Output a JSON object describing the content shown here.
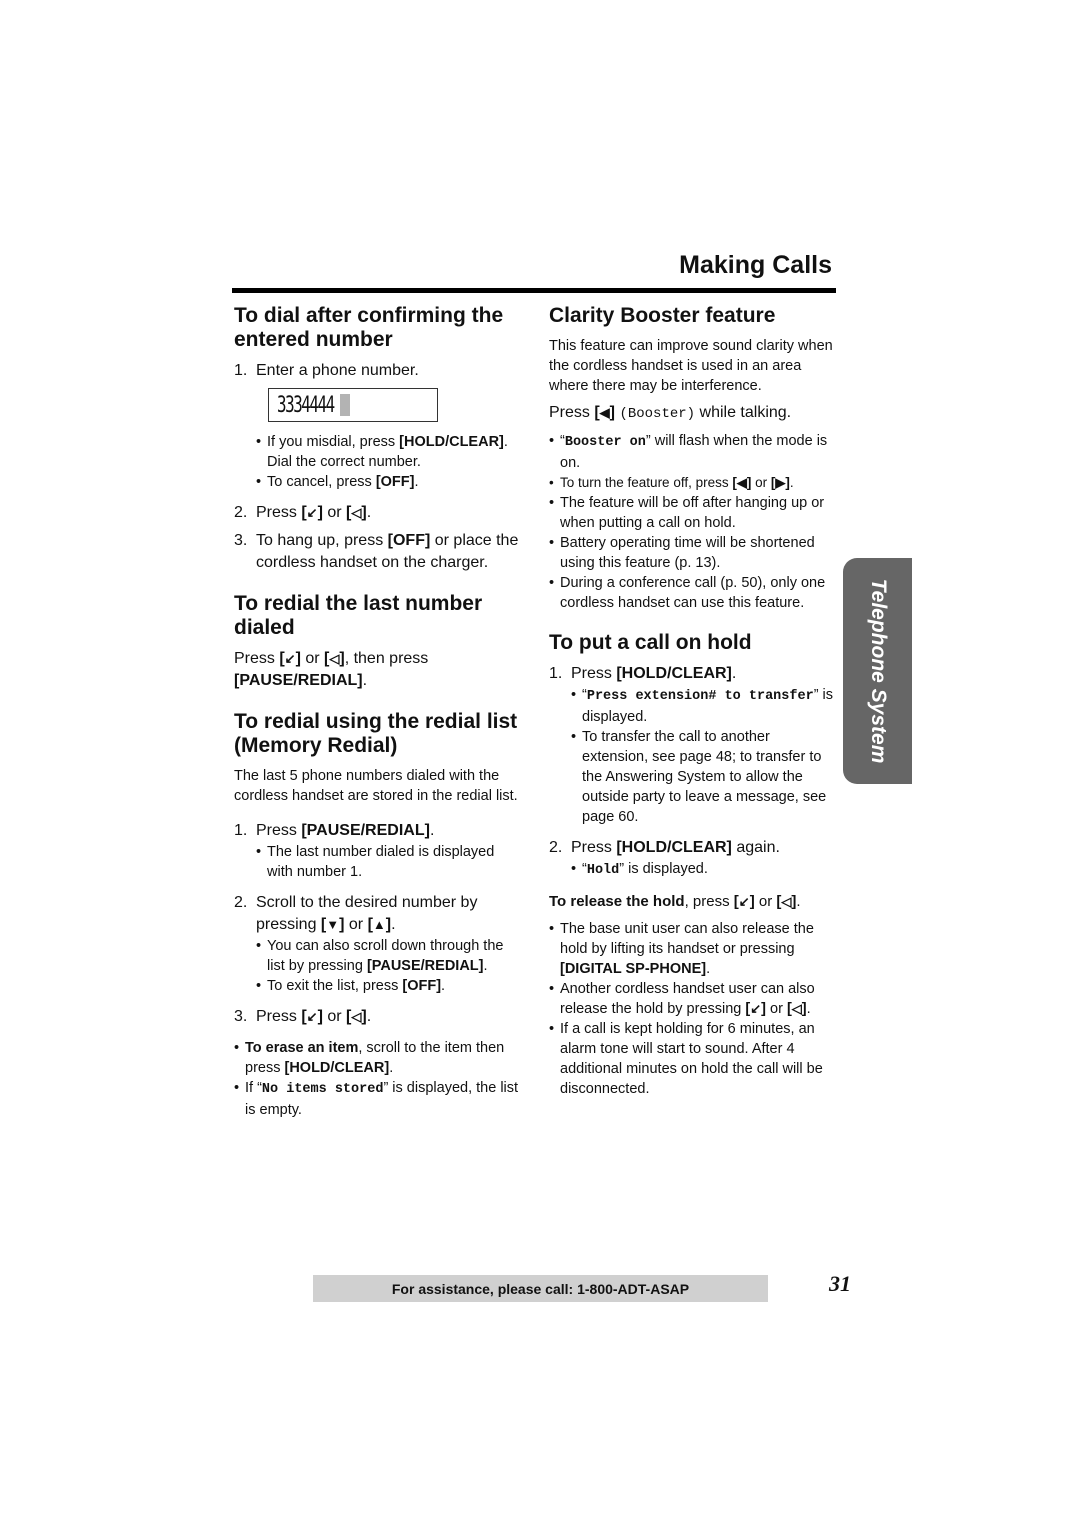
{
  "header": {
    "title": "Making Calls"
  },
  "side_tab": {
    "label": "Telephone System"
  },
  "icons": {
    "talk": "↙",
    "speaker": "◁",
    "down": "▼",
    "up": "▲",
    "left": "◀",
    "right": "▶"
  },
  "left": {
    "dial_confirm": {
      "heading": "To dial after confirming the entered number",
      "step1": {
        "num": "1.",
        "text": "Enter a phone number."
      },
      "display": {
        "digits": "3334444"
      },
      "bullets": {
        "b1_pre": "If you misdial, press ",
        "b1_key": "[HOLD/CLEAR]",
        "b1_post": ". Dial the correct number.",
        "b2_pre": "To cancel, press ",
        "b2_key": "[OFF]",
        "b2_post": "."
      },
      "step2": {
        "num": "2.",
        "pre": "Press ",
        "or": " or ",
        "post": "."
      },
      "step3": {
        "num": "3.",
        "pre": "To hang up, press ",
        "key": "[OFF]",
        "post": " or place the cordless handset on the charger."
      }
    },
    "redial_last": {
      "heading": "To redial the last number dialed",
      "pre": "Press ",
      "or": " or ",
      "mid": ", then press ",
      "key": "[PAUSE/REDIAL]",
      "post": "."
    },
    "memory_redial": {
      "heading": "To redial using the redial list (Memory Redial)",
      "intro": "The last 5 phone numbers dialed with the cordless handset are stored in the redial list.",
      "step1": {
        "num": "1.",
        "pre": "Press ",
        "key": "[PAUSE/REDIAL]",
        "post": "."
      },
      "step1_bullet": "The last number dialed is displayed with number 1.",
      "step2": {
        "num": "2.",
        "pre": "Scroll to the desired number by pressing ",
        "or": " or ",
        "post": "."
      },
      "step2_bullets": {
        "b1_pre": "You can also scroll down through the list by pressing ",
        "b1_key": "[PAUSE/REDIAL]",
        "b1_post": ".",
        "b2_pre": "To exit the list, press ",
        "b2_key": "[OFF]",
        "b2_post": "."
      },
      "step3": {
        "num": "3.",
        "pre": "Press ",
        "or": " or ",
        "post": "."
      },
      "notes": {
        "n1_bold": "To erase an item",
        "n1_mid": ", scroll to the item then press ",
        "n1_key": "[HOLD/CLEAR]",
        "n1_post": ".",
        "n2_pre": "If “",
        "n2_mono": "No items stored",
        "n2_post": "” is displayed, the list is empty."
      }
    }
  },
  "right": {
    "clarity": {
      "heading": "Clarity Booster feature",
      "intro": "This feature can improve sound clarity when the cordless handset is used in an area where there may be interference.",
      "instr_pre": "Press ",
      "instr_mono": "(Booster)",
      "instr_post": " while talking.",
      "bullets": {
        "b1_open": "“",
        "b1_mono": "Booster on",
        "b1_post": "” will flash when the mode is on.",
        "b2_pre": "To turn the feature off, press ",
        "b2_or": " or ",
        "b2_post": ".",
        "b3": "The feature will be off after hanging up or when putting a call on hold.",
        "b4": "Battery operating time will be shortened using this feature (p. 13).",
        "b5": "During a conference call (p. 50), only one cordless handset can use this feature."
      }
    },
    "hold": {
      "heading": "To put a call on hold",
      "step1": {
        "num": "1.",
        "pre": "Press ",
        "key": "[HOLD/CLEAR]",
        "post": "."
      },
      "step1_bullets": {
        "b1_open": "“",
        "b1_mono": "Press extension# to transfer",
        "b1_post": "” is displayed.",
        "b2": "To transfer the call to another extension, see page 48; to transfer to the Answering System to allow the outside party to leave a message, see page 60."
      },
      "step2": {
        "num": "2.",
        "pre": "Press ",
        "key": "[HOLD/CLEAR]",
        "post": " again."
      },
      "step2_bullet": {
        "open": "“",
        "mono": "Hold",
        "post": "” is displayed."
      },
      "release": {
        "bold": "To release the hold",
        "pre": ", press ",
        "or": " or ",
        "post": "."
      },
      "release_bullets": {
        "b1_pre": "The base unit user can also release the hold by lifting its handset or pressing ",
        "b1_key": "[DIGITAL SP-PHONE]",
        "b1_post": ".",
        "b2_pre": "Another cordless handset user can also release the hold by pressing ",
        "b2_or": " or ",
        "b2_post": ".",
        "b3": "If a call is kept holding for 6 minutes, an alarm tone will start to sound. After 4 additional minutes on hold the call will be disconnected."
      }
    }
  },
  "footer": {
    "assistance": "For assistance, please call: 1-800-ADT-ASAP",
    "page_number": "31"
  }
}
